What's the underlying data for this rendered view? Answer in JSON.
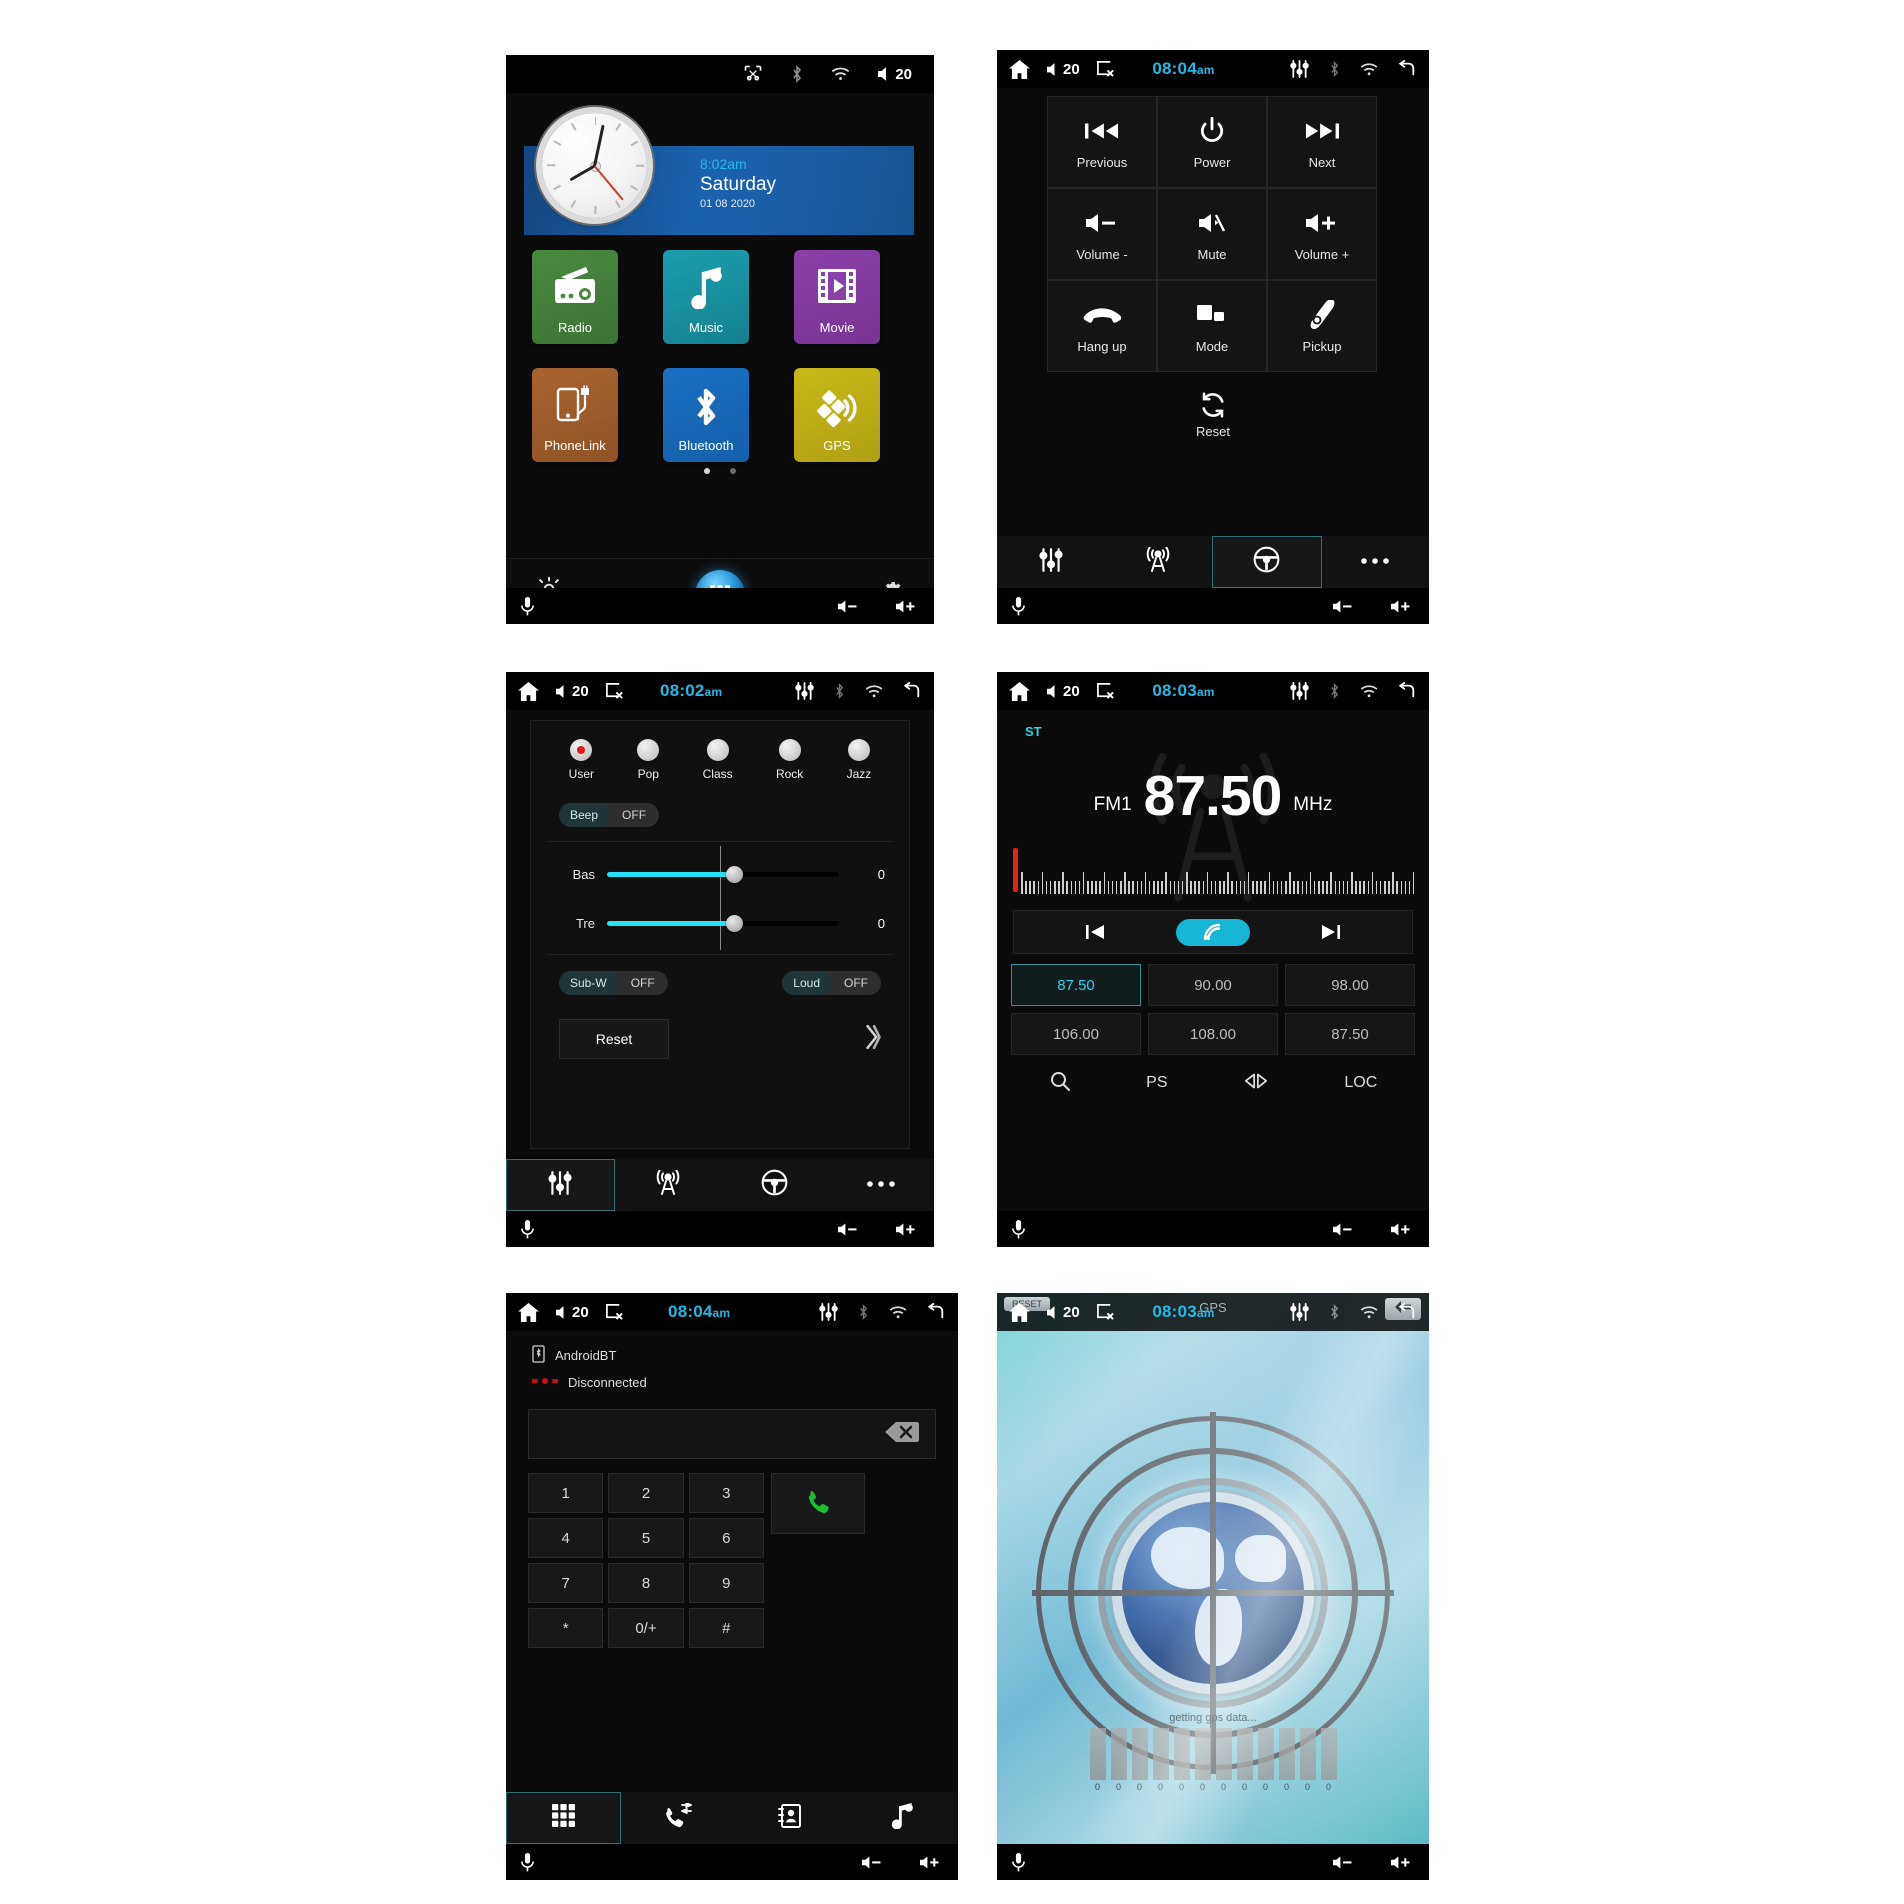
{
  "common": {
    "volume_level": "20",
    "mic_label": "microphone",
    "vol_down_label": "volume-down",
    "vol_up_label": "volume-up"
  },
  "panel_home": {
    "status": {
      "volume": "20",
      "time": "",
      "ampm": ""
    },
    "clock_widget": {
      "time": "8:02am",
      "day": "Saturday",
      "date": "01 08 2020"
    },
    "tiles": [
      {
        "label": "Radio",
        "icon": "radio-icon",
        "color": "#4a8a40"
      },
      {
        "label": "Music",
        "icon": "music-note-icon",
        "color": "#1a9fb0"
      },
      {
        "label": "Movie",
        "icon": "film-play-icon",
        "color": "#8b3fa8"
      },
      {
        "label": "PhoneLink",
        "icon": "phone-usb-icon",
        "color": "#a9632f"
      },
      {
        "label": "Bluetooth",
        "icon": "bluetooth-icon",
        "color": "#1a6fc4"
      },
      {
        "label": "GPS",
        "icon": "satellite-icon",
        "color": "#c9b818"
      }
    ],
    "dock": {
      "brightness_label": "brightness-icon",
      "settings_label": "gear-icon",
      "drawer_label": "app-drawer-icon"
    },
    "page_dots": 2,
    "active_dot": 0
  },
  "panel_steering": {
    "status": {
      "volume": "20",
      "time": "08:04",
      "ampm": "am"
    },
    "buttons": [
      {
        "label": "Previous",
        "icon": "skip-previous-icon"
      },
      {
        "label": "Power",
        "icon": "power-icon"
      },
      {
        "label": "Next",
        "icon": "skip-next-icon"
      },
      {
        "label": "Volume -",
        "icon": "volume-down-icon"
      },
      {
        "label": "Mute",
        "icon": "volume-mute-icon"
      },
      {
        "label": "Volume +",
        "icon": "volume-up-icon"
      },
      {
        "label": "Hang up",
        "icon": "phone-hangup-icon"
      },
      {
        "label": "Mode",
        "icon": "mode-squares-icon"
      },
      {
        "label": "Pickup",
        "icon": "phone-pickup-icon"
      }
    ],
    "reset": {
      "label": "Reset",
      "icon": "refresh-icon"
    },
    "tabs": [
      {
        "name": "equalizer",
        "icon": "equalizer-icon",
        "selected": false
      },
      {
        "name": "radio",
        "icon": "radio-tower-icon",
        "selected": false
      },
      {
        "name": "steering-wheel",
        "icon": "steering-wheel-icon",
        "selected": true
      },
      {
        "name": "more",
        "icon": "more-dots-icon",
        "selected": false
      }
    ]
  },
  "panel_eq": {
    "status": {
      "volume": "20",
      "time": "08:02",
      "ampm": "am"
    },
    "presets": [
      {
        "label": "User",
        "selected": true
      },
      {
        "label": "Pop",
        "selected": false
      },
      {
        "label": "Class",
        "selected": false
      },
      {
        "label": "Rock",
        "selected": false
      },
      {
        "label": "Jazz",
        "selected": false
      }
    ],
    "toggles": [
      {
        "key": "Beep",
        "value": "OFF"
      },
      {
        "key": "Sub-W",
        "value": "OFF"
      },
      {
        "key": "Loud",
        "value": "OFF"
      }
    ],
    "sliders": [
      {
        "label": "Bas",
        "value": "0",
        "percent": 55
      },
      {
        "label": "Tre",
        "value": "0",
        "percent": 55
      }
    ],
    "reset_label": "Reset",
    "next_label": "next-page-chevron",
    "tabs": [
      {
        "name": "equalizer",
        "icon": "equalizer-icon",
        "selected": true
      },
      {
        "name": "radio",
        "icon": "radio-tower-icon",
        "selected": false
      },
      {
        "name": "steering-wheel",
        "icon": "steering-wheel-icon",
        "selected": false
      },
      {
        "name": "more",
        "icon": "more-dots-icon",
        "selected": false
      }
    ]
  },
  "panel_radio": {
    "status": {
      "volume": "20",
      "time": "08:03",
      "ampm": "am"
    },
    "stereo_badge": "ST",
    "band": "FM1",
    "frequency": "87.50",
    "unit": "MHz",
    "seek": {
      "prev": "seek-previous-icon",
      "scan": "scan-icon",
      "next": "seek-next-icon"
    },
    "presets": [
      {
        "value": "87.50",
        "selected": true
      },
      {
        "value": "90.00",
        "selected": false
      },
      {
        "value": "98.00",
        "selected": false
      },
      {
        "value": "106.00",
        "selected": false
      },
      {
        "value": "108.00",
        "selected": false
      },
      {
        "value": "87.50",
        "selected": false
      }
    ],
    "tools": [
      {
        "label": "",
        "icon": "search-icon"
      },
      {
        "label": "PS",
        "icon": ""
      },
      {
        "label": "",
        "icon": "stereo-icon"
      },
      {
        "label": "LOC",
        "icon": ""
      }
    ]
  },
  "panel_bt": {
    "status": {
      "volume": "20",
      "time": "08:04",
      "ampm": "am"
    },
    "device_name": "AndroidBT",
    "connection_status": "Disconnected",
    "dial_value": "",
    "dial_placeholder": "",
    "backspace_label": "backspace-icon",
    "keys": [
      "1",
      "2",
      "3",
      "4",
      "5",
      "6",
      "7",
      "8",
      "9",
      "*",
      "0/+",
      "#"
    ],
    "call_label": "call-icon",
    "tabs": [
      {
        "name": "keypad",
        "icon": "keypad-icon",
        "selected": true
      },
      {
        "name": "call-history",
        "icon": "call-history-icon",
        "selected": false
      },
      {
        "name": "contacts",
        "icon": "contacts-icon",
        "selected": false
      },
      {
        "name": "bt-music",
        "icon": "music-note-icon",
        "selected": false
      }
    ]
  },
  "panel_gps": {
    "status": {
      "volume": "20",
      "time": "08:03",
      "ampm": "am"
    },
    "app_title": "GPS",
    "reset_label": "RESET",
    "status_text": "getting gps data...",
    "satellite_values": [
      "0",
      "0",
      "0",
      "0",
      "0",
      "0",
      "0",
      "0",
      "0",
      "0",
      "0",
      "0"
    ]
  }
}
